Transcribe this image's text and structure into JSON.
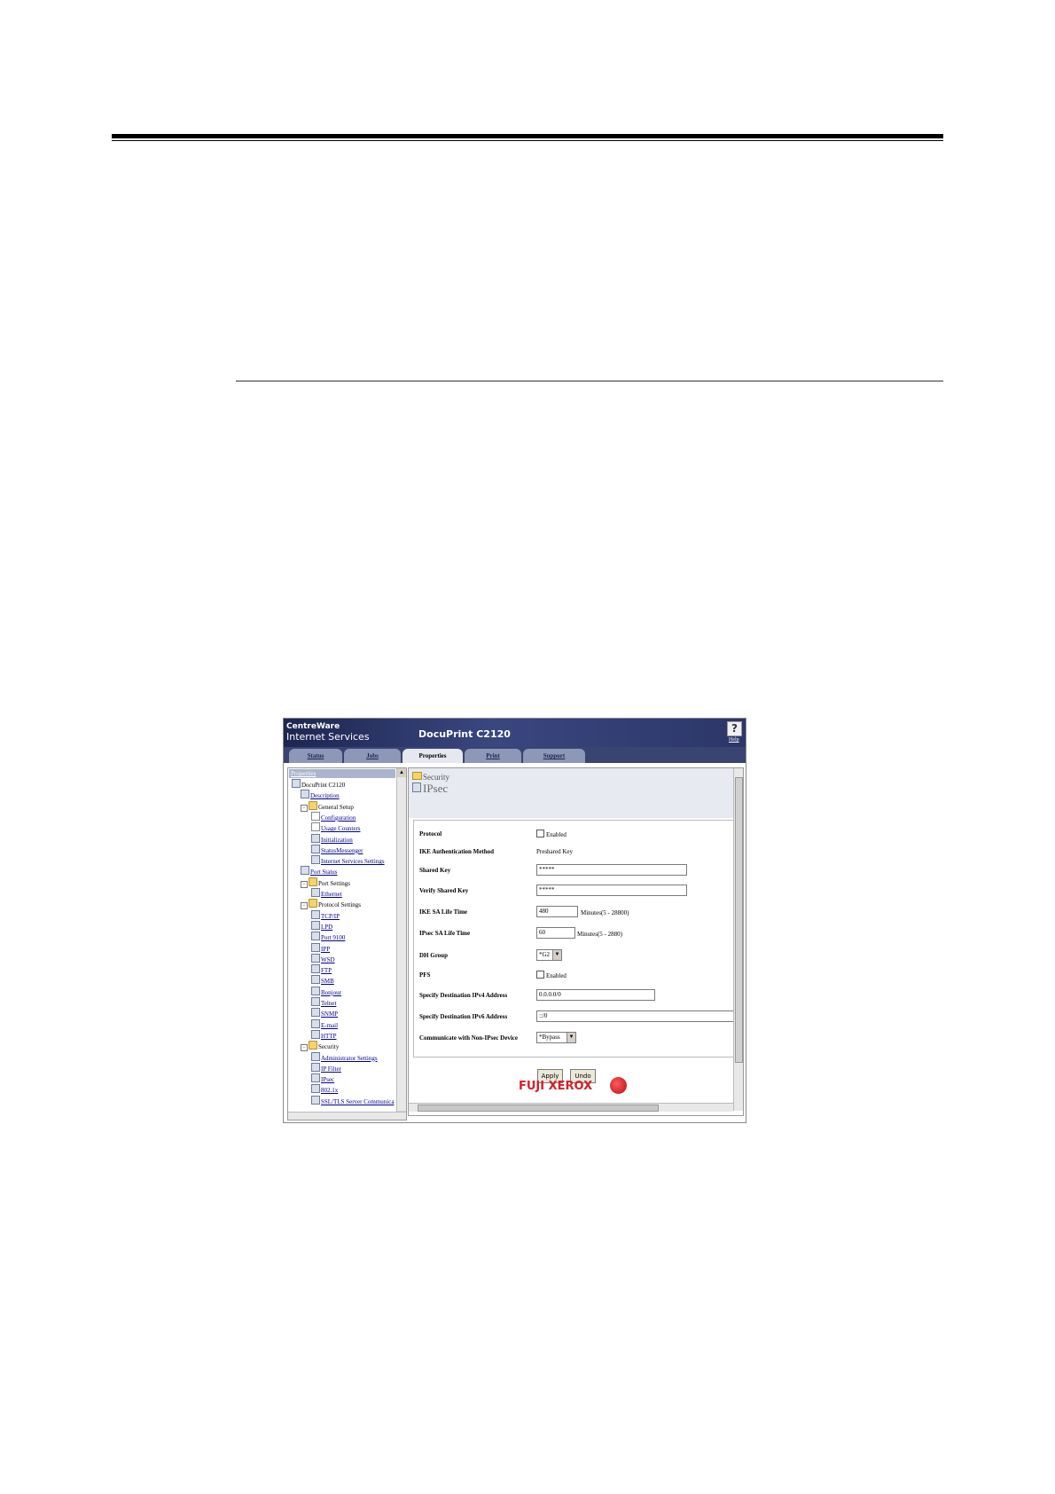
{
  "banner": {
    "brand_line1": "CentreWare",
    "brand_line2": "Internet Services",
    "product": "DocuPrint C2120",
    "help_label": "Help"
  },
  "tabs": [
    "Status",
    "Jobs",
    "Properties",
    "Print",
    "Support"
  ],
  "active_tab": "Properties",
  "tree": {
    "header": "Properties",
    "items": [
      {
        "label": "DocuPrint C2120",
        "level": 0,
        "type": "root",
        "link": false
      },
      {
        "label": "Description",
        "level": 1,
        "type": "page",
        "link": true
      },
      {
        "label": "General Setup",
        "level": 1,
        "type": "folder",
        "link": false
      },
      {
        "label": "Configuration",
        "level": 2,
        "type": "blank",
        "link": true
      },
      {
        "label": "Usage Counters",
        "level": 2,
        "type": "blank",
        "link": true
      },
      {
        "label": "Initialization",
        "level": 2,
        "type": "page",
        "link": true
      },
      {
        "label": "StatusMessenger",
        "level": 2,
        "type": "page",
        "link": true
      },
      {
        "label": "Internet Services Settings",
        "level": 2,
        "type": "page",
        "link": true
      },
      {
        "label": "Port Status",
        "level": 1,
        "type": "page",
        "link": true
      },
      {
        "label": "Port Settings",
        "level": 1,
        "type": "folder",
        "link": false
      },
      {
        "label": "Ethernet",
        "level": 2,
        "type": "page",
        "link": true
      },
      {
        "label": "Protocol Settings",
        "level": 1,
        "type": "folder",
        "link": false
      },
      {
        "label": "TCP/IP",
        "level": 2,
        "type": "page",
        "link": true
      },
      {
        "label": "LPD",
        "level": 2,
        "type": "page",
        "link": true
      },
      {
        "label": "Port 9100",
        "level": 2,
        "type": "page",
        "link": true
      },
      {
        "label": "IPP",
        "level": 2,
        "type": "page",
        "link": true
      },
      {
        "label": "WSD",
        "level": 2,
        "type": "page",
        "link": true
      },
      {
        "label": "FTP",
        "level": 2,
        "type": "page",
        "link": true
      },
      {
        "label": "SMB",
        "level": 2,
        "type": "page",
        "link": true
      },
      {
        "label": "Bonjour",
        "level": 2,
        "type": "page",
        "link": true
      },
      {
        "label": "Telnet",
        "level": 2,
        "type": "page",
        "link": true
      },
      {
        "label": "SNMP",
        "level": 2,
        "type": "page",
        "link": true
      },
      {
        "label": "E-mail",
        "level": 2,
        "type": "page",
        "link": true
      },
      {
        "label": "HTTP",
        "level": 2,
        "type": "page",
        "link": true
      },
      {
        "label": "Security",
        "level": 1,
        "type": "folder",
        "link": false
      },
      {
        "label": "Administrator Settings",
        "level": 2,
        "type": "page",
        "link": true
      },
      {
        "label": "IP Filter",
        "level": 2,
        "type": "page",
        "link": true
      },
      {
        "label": "IPsec",
        "level": 2,
        "type": "page",
        "link": true
      },
      {
        "label": "802.1x",
        "level": 2,
        "type": "page",
        "link": true
      },
      {
        "label": "SSL/TLS Server Communica",
        "level": 2,
        "type": "page",
        "link": true
      }
    ]
  },
  "page": {
    "breadcrumb": "Security",
    "title": "IPsec"
  },
  "form": {
    "protocol_label": "Protocol",
    "protocol_check": "Enabled",
    "ike_auth_label": "IKE Authentication Method",
    "ike_auth_value": "Preshared Key",
    "shared_key_label": "Shared Key",
    "shared_key_value": "*****",
    "verify_key_label": "Verify Shared Key",
    "verify_key_value": "*****",
    "ike_life_label": "IKE SA Life Time",
    "ike_life_value": "480",
    "ike_life_unit": "Minutes(5 - 28800)",
    "ipsec_life_label": "IPsec SA Life Time",
    "ipsec_life_value": "60",
    "ipsec_life_unit": "Minutes(5 - 2880)",
    "dh_label": "DH Group",
    "dh_value": "*G2",
    "pfs_label": "PFS",
    "pfs_check": "Enabled",
    "ipv4_label": "Specify Destination IPv4 Address",
    "ipv4_value": "0.0.0.0/0",
    "ipv6_label": "Specify Destination IPv6 Address",
    "ipv6_value": "::/0",
    "nonipsec_label": "Communicate with Non-IPsec Device",
    "nonipsec_value": "*Bypass"
  },
  "buttons": {
    "apply": "Apply",
    "undo": "Undo"
  },
  "logo_text": "FUJI XEROX",
  "colors": {
    "banner": "#1d2650",
    "link": "#00008b",
    "logo": "#d4212a"
  }
}
